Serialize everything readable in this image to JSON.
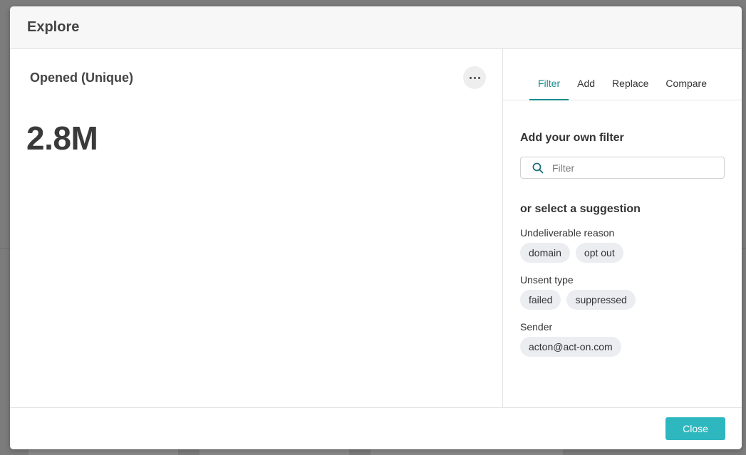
{
  "modal": {
    "title": "Explore",
    "close_label": "Close"
  },
  "metric": {
    "title": "Opened (Unique)",
    "value": "2.8M"
  },
  "tabs": [
    {
      "label": "Filter",
      "active": true
    },
    {
      "label": "Add",
      "active": false
    },
    {
      "label": "Replace",
      "active": false
    },
    {
      "label": "Compare",
      "active": false
    }
  ],
  "filter": {
    "heading": "Add your own filter",
    "placeholder": "Filter",
    "suggestion_heading": "or select a suggestion",
    "groups": [
      {
        "label": "Undeliverable reason",
        "chips": [
          "domain",
          "opt out"
        ]
      },
      {
        "label": "Unsent type",
        "chips": [
          "failed",
          "suppressed"
        ]
      },
      {
        "label": "Sender",
        "chips": [
          "acton@act-on.com"
        ]
      }
    ]
  },
  "colors": {
    "accent": "#168b8b",
    "primary_button": "#2fb7bf",
    "chip_bg": "#ebedf0"
  }
}
